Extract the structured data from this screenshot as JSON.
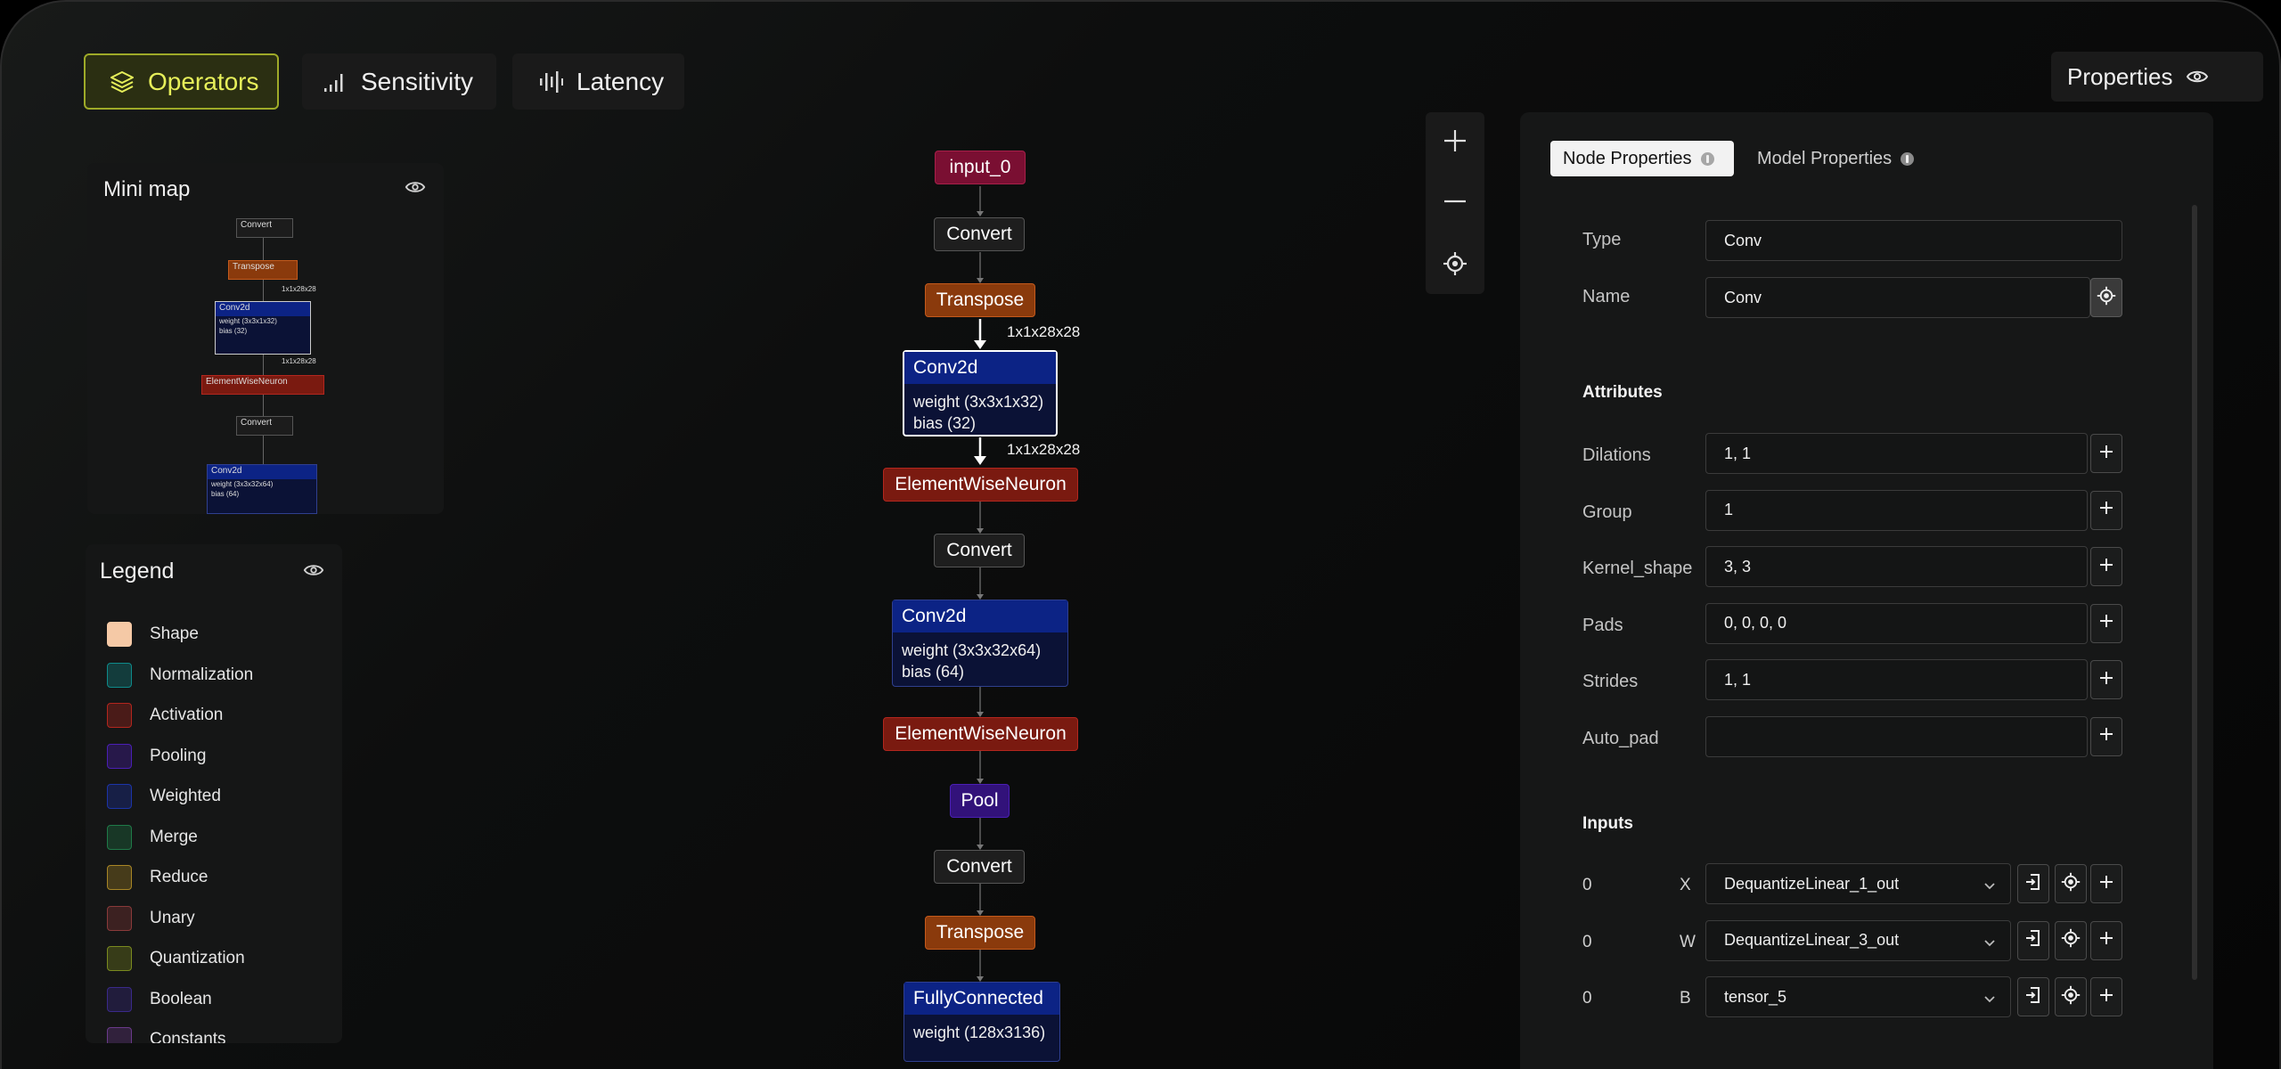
{
  "toolbar": {
    "tabs": [
      {
        "label": "Operators",
        "icon": "layers-icon",
        "active": true
      },
      {
        "label": "Sensitivity",
        "icon": "signal-bars-icon"
      },
      {
        "label": "Latency",
        "icon": "waveform-icon"
      }
    ],
    "properties_label": "Properties"
  },
  "minimap": {
    "title": "Mini map",
    "nodes": [
      "Convert",
      "Transpose",
      "Conv2d",
      "weight (3x3x1x32)",
      "bias (32)",
      "ElementWiseNeuron",
      "Convert",
      "Conv2d",
      "weight (3x3x32x64)",
      "bias (64)"
    ],
    "edge_labels": [
      "1x1x28x28",
      "1x1x28x28"
    ]
  },
  "legend": {
    "title": "Legend",
    "items": [
      {
        "label": "Shape",
        "color": "#f5c9a6"
      },
      {
        "label": "Normalization",
        "color": "#0e8a8a"
      },
      {
        "label": "Activation",
        "color": "#b3261e"
      },
      {
        "label": "Pooling",
        "color": "#4a1fb5"
      },
      {
        "label": "Weighted",
        "color": "#1c34a8"
      },
      {
        "label": "Merge",
        "color": "#1f7a48"
      },
      {
        "label": "Reduce",
        "color": "#a88625"
      },
      {
        "label": "Unary",
        "color": "#8a3a3a"
      },
      {
        "label": "Quantization",
        "color": "#7a8a1f"
      },
      {
        "label": "Boolean",
        "color": "#3a2a8a"
      },
      {
        "label": "Constants",
        "color": "#6a3a8a"
      }
    ]
  },
  "graph": {
    "nodes": [
      {
        "label": "input_0",
        "kind": "input"
      },
      {
        "label": "Convert",
        "kind": "convert"
      },
      {
        "label": "Transpose",
        "kind": "shape"
      },
      {
        "label": "Conv2d",
        "kind": "weighted",
        "lines": [
          "weight (3x3x1x32)",
          "bias (32)"
        ],
        "selected": true
      },
      {
        "label": "ElementWiseNeuron",
        "kind": "activation"
      },
      {
        "label": "Convert",
        "kind": "convert"
      },
      {
        "label": "Conv2d",
        "kind": "weighted",
        "lines": [
          "weight (3x3x32x64)",
          "bias (64)"
        ]
      },
      {
        "label": "ElementWiseNeuron",
        "kind": "activation"
      },
      {
        "label": "Pool",
        "kind": "pooling"
      },
      {
        "label": "Convert",
        "kind": "convert"
      },
      {
        "label": "Transpose",
        "kind": "shape"
      },
      {
        "label": "FullyConnected",
        "kind": "weighted",
        "lines": [
          "weight (128x3136)"
        ]
      }
    ],
    "edge_labels": [
      "1x1x28x28",
      "1x1x28x28"
    ]
  },
  "zoom": {
    "in_icon": "plus-icon",
    "out_icon": "minus-icon",
    "fit_icon": "crosshair-icon"
  },
  "properties": {
    "tabs": [
      "Node Properties",
      "Model Properties"
    ],
    "type_label": "Type",
    "type_value": "Conv",
    "name_label": "Name",
    "name_value": "Conv",
    "attributes_title": "Attributes",
    "attributes": [
      {
        "label": "Dilations",
        "value": "1, 1"
      },
      {
        "label": "Group",
        "value": "1"
      },
      {
        "label": "Kernel_shape",
        "value": "3, 3"
      },
      {
        "label": "Pads",
        "value": "0, 0, 0, 0"
      },
      {
        "label": "Strides",
        "value": "1, 1"
      },
      {
        "label": "Auto_pad",
        "value": ""
      }
    ],
    "inputs_title": "Inputs",
    "inputs": [
      {
        "index": "0",
        "name": "X",
        "value": "DequantizeLinear_1_out"
      },
      {
        "index": "0",
        "name": "W",
        "value": "DequantizeLinear_3_out"
      },
      {
        "index": "0",
        "name": "B",
        "value": "tensor_5"
      }
    ]
  }
}
